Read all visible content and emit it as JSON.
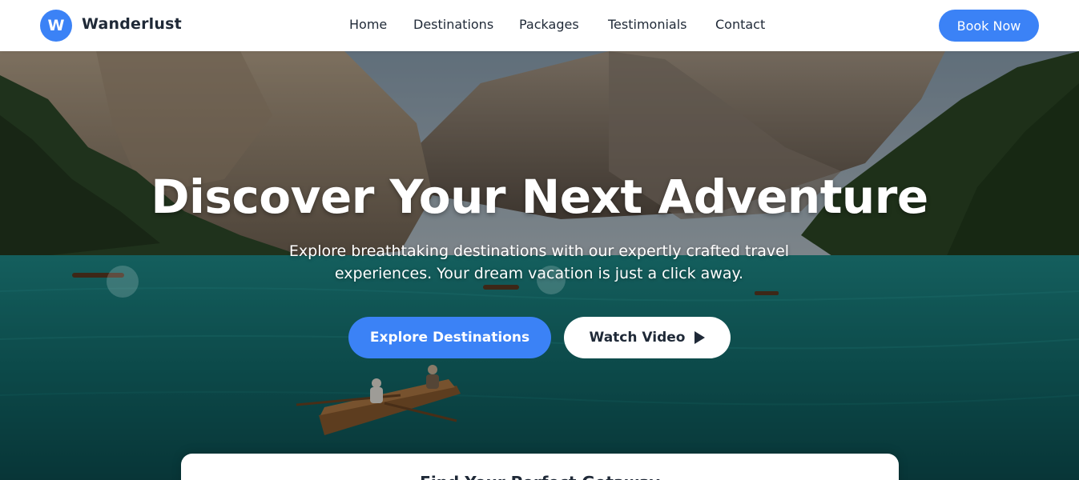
{
  "brand": {
    "logo_letter": "W",
    "name": "Wanderlust",
    "accent": "#3b82f6"
  },
  "nav": {
    "items": [
      "Home",
      "Destinations",
      "Packages",
      "Testimonials",
      "Contact"
    ],
    "cta": "Book Now"
  },
  "hero": {
    "title": "Discover Your Next Adventure",
    "subtitle": "Explore breathtaking destinations with our expertly crafted travel experiences. Your dream vacation is just a click away.",
    "primary_button": "Explore Destinations",
    "secondary_button": "Watch Video",
    "secondary_icon": "play-icon"
  },
  "search_card": {
    "title": "Find Your Perfect Getaway"
  }
}
